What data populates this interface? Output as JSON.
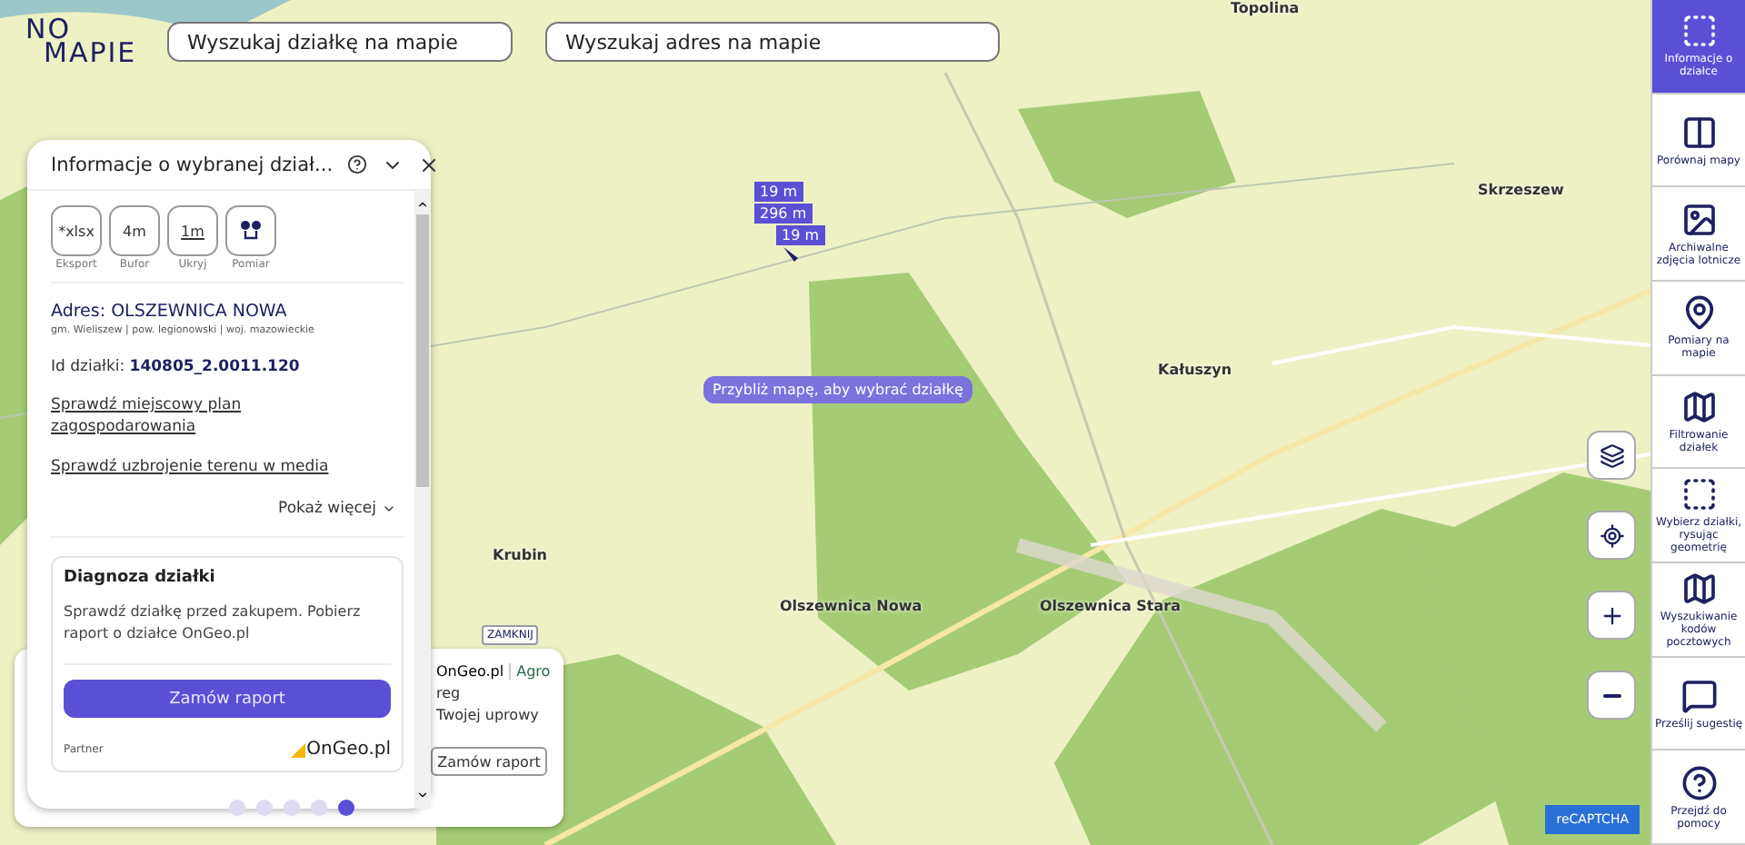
{
  "logo": {
    "line1": "NO",
    "line2": "MAPIE"
  },
  "search_fields": [
    {
      "placeholder": "Wyszukaj działkę na mapie"
    },
    {
      "placeholder": "Wyszukaj adres na mapie"
    }
  ],
  "map": {
    "places": [
      "Topolina",
      "Skrzeszew",
      "Kałuszyn",
      "Krubin",
      "Olszewnica Nowa",
      "Olszewnica Stara"
    ],
    "measure_labels": [
      "19 m",
      "296 m",
      "19 m"
    ],
    "hint": "Przybliż mapę, aby wybrać działkę"
  },
  "info_panel": {
    "title": "Informacje o wybranej dział...",
    "tools": [
      {
        "kind": "text",
        "glyph": "*xlsx",
        "caption": "Eksport",
        "underlined": false
      },
      {
        "kind": "text",
        "glyph": "4m",
        "caption": "Bufor",
        "underlined": false
      },
      {
        "kind": "text",
        "glyph": "1m",
        "caption": "Ukryj",
        "underlined": true
      },
      {
        "kind": "pins",
        "caption": "Pomiar"
      }
    ],
    "address": "Adres: OLSZEWNICA NOWA",
    "address_detail": "gm. Wieliszew | pow. legionowski | woj. mazowieckie",
    "parcel_id": "Id działki: **140805_2.0011.120**",
    "links": [
      "Sprawdź miejscowy plan zagospodarowania",
      "Sprawdź uzbrojenie terenu w media"
    ],
    "show_more": "Pokaż więcej",
    "diagnosis": {
      "title": "Diagnoza działki",
      "text": "Sprawdź działkę przed zakupem. Pobierz raport o działce OnGeo.pl",
      "button": "Zamów raport",
      "partner": "Partner",
      "partner_logo": "OnGeo.pl"
    }
  },
  "ad_card": {
    "close": "ZAMKNIJ",
    "brand": "OnGeo.pl",
    "brand_tag": "Agro",
    "line1": "reg",
    "line2": "Twojej uprowy",
    "button": "Zamów raport"
  },
  "pager": [
    {
      "selected": false
    },
    {
      "selected": false
    },
    {
      "selected": false
    },
    {
      "selected": false
    },
    {
      "selected": true
    }
  ],
  "map_controls": [
    {
      "kind": "layers"
    },
    {
      "kind": "locate"
    },
    {
      "kind": "zoom_in"
    },
    {
      "kind": "zoom_out"
    }
  ],
  "recaptcha": "reCAPTCHA",
  "sidebar": [
    {
      "kind": "info",
      "label": "Informacje o działce",
      "selected": true
    },
    {
      "kind": "compare",
      "label": "Porównaj mapy",
      "selected": false
    },
    {
      "kind": "photo",
      "label": "Archiwalne zdjęcia lotnicze",
      "selected": false
    },
    {
      "kind": "measure",
      "label": "Pomiary na mapie",
      "selected": false
    },
    {
      "kind": "filter",
      "label": "Filtrowanie działek",
      "selected": false
    },
    {
      "kind": "select",
      "label": "Wybierz działki, rysując geometrię",
      "selected": false
    },
    {
      "kind": "postal",
      "label": "Wyszukiwanie kodów pocztowych",
      "selected": false
    },
    {
      "kind": "suggest",
      "label": "Prześlij sugestię",
      "selected": false
    },
    {
      "kind": "help",
      "label": "Przejdź do pomocy",
      "selected": false
    }
  ]
}
